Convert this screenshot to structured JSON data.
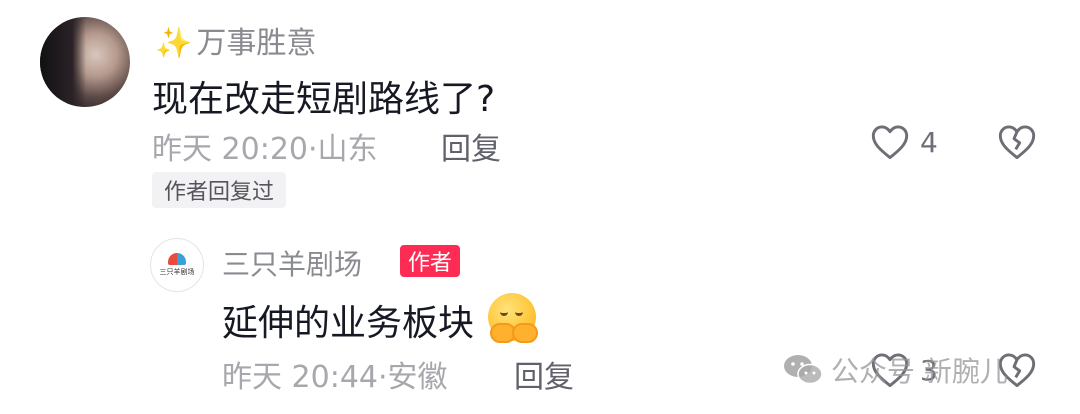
{
  "comment": {
    "username": "万事胜意",
    "username_prefix_icon": "sparkles-icon",
    "text": "现在改走短剧路线了?",
    "time": "昨天 20:20",
    "location": "山东",
    "reply_label": "回复",
    "like_count": "4",
    "author_replied_badge": "作者回复过"
  },
  "reply": {
    "author_name": "三只羊剧场",
    "author_tag": "作者",
    "avatar_logo_text": "三只羊剧场",
    "text": "延伸的业务板块",
    "emoji": "hugging-face-emoji",
    "time": "昨天 20:44",
    "location": "安徽",
    "reply_label": "回复",
    "like_count": "3"
  },
  "watermark": {
    "icon": "wechat-icon",
    "text": "公众号 新腕儿"
  },
  "colors": {
    "accent": "#fe2c55",
    "text_primary": "#161823",
    "text_secondary": "#a7a8ad"
  }
}
